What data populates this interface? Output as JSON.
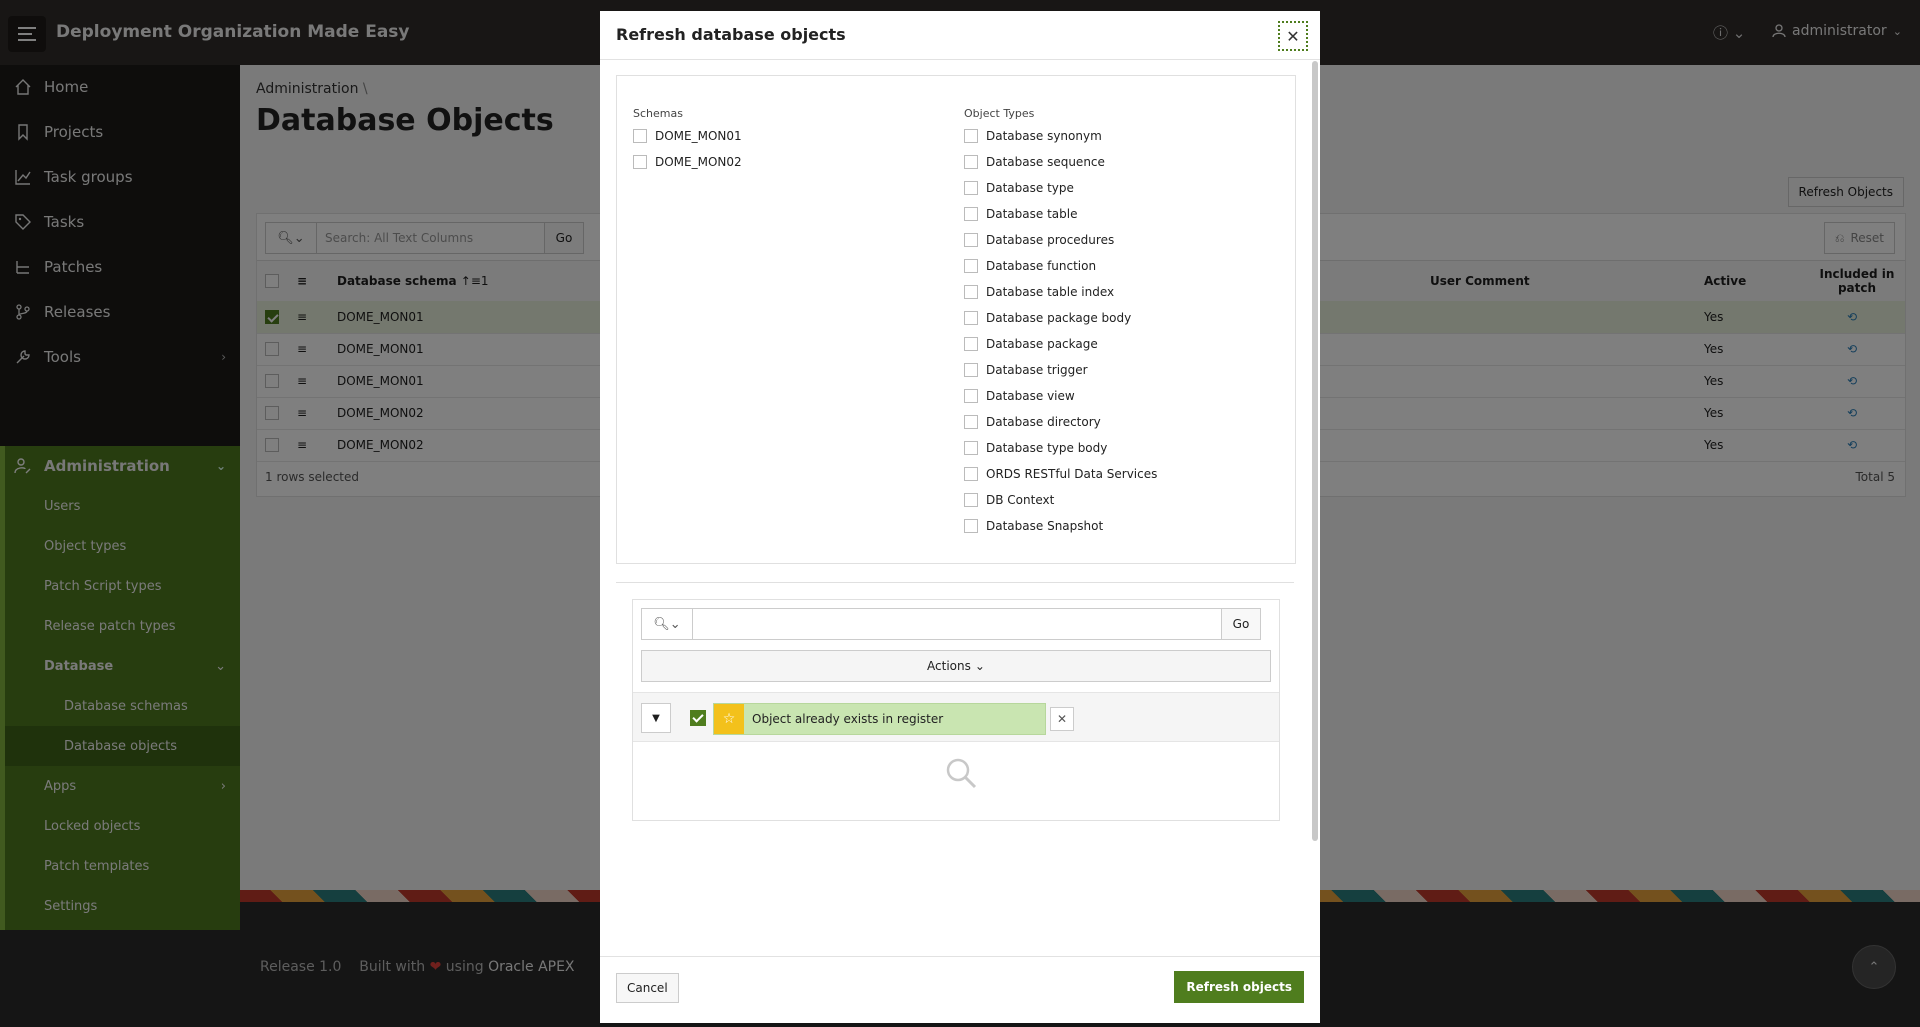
{
  "app": {
    "title": "Deployment Organization Made Easy",
    "user": "administrator",
    "help_icon": "help-icon"
  },
  "sidebar": {
    "items": [
      {
        "label": "Home",
        "icon": "home-icon"
      },
      {
        "label": "Projects",
        "icon": "bookmark-icon"
      },
      {
        "label": "Task groups",
        "icon": "chart-line-icon"
      },
      {
        "label": "Tasks",
        "icon": "tags-icon"
      },
      {
        "label": "Patches",
        "icon": "sitemap-icon"
      },
      {
        "label": "Releases",
        "icon": "git-branch-icon"
      },
      {
        "label": "Tools",
        "icon": "wrench-icon"
      },
      {
        "label": "Administration",
        "icon": "user-wrench-icon"
      }
    ],
    "admin_sub": [
      "Users",
      "Object types",
      "Patch Script types",
      "Release patch types",
      "Database",
      "Database schemas",
      "Database objects",
      "Apps",
      "Locked objects",
      "Patch templates",
      "Settings"
    ],
    "accent": "#4e7a1e"
  },
  "page": {
    "breadcrumb": "Administration",
    "breadcrumb_sep": "\\",
    "title": "Database Objects",
    "refresh_button": "Refresh Objects",
    "search_placeholder": "Search: All Text Columns",
    "go": "Go",
    "reset": "Reset",
    "columns": {
      "schema": "Database schema",
      "sort_indicator": "↑≡1",
      "comment": "User Comment",
      "active": "Active",
      "included": "Included in patch"
    },
    "rows": [
      {
        "schema": "DOME_MON01",
        "active": "Yes",
        "selected": true
      },
      {
        "schema": "DOME_MON01",
        "active": "Yes",
        "selected": false
      },
      {
        "schema": "DOME_MON01",
        "active": "Yes",
        "selected": false
      },
      {
        "schema": "DOME_MON02",
        "active": "Yes",
        "selected": false
      },
      {
        "schema": "DOME_MON02",
        "active": "Yes",
        "selected": false
      }
    ],
    "selected_text": "1 rows selected",
    "total_text": "Total 5"
  },
  "footer": {
    "release": "Release 1.0",
    "built_with": "Built with",
    "using": "using",
    "apex": "Oracle APEX"
  },
  "dialog": {
    "title": "Refresh database objects",
    "schemas_label": "Schemas",
    "schemas": [
      "DOME_MON01",
      "DOME_MON02"
    ],
    "types_label": "Object Types",
    "types": [
      "Database synonym",
      "Database sequence",
      "Database type",
      "Database table",
      "Database procedures",
      "Database function",
      "Database table index",
      "Database package body",
      "Database package",
      "Database trigger",
      "Database view",
      "Database directory",
      "Database type body",
      "ORDS RESTful Data Services",
      "DB Context",
      "Database Snapshot"
    ],
    "go": "Go",
    "actions": "Actions",
    "filter_chip": "Object already exists in register",
    "cancel": "Cancel",
    "refresh": "Refresh objects"
  }
}
